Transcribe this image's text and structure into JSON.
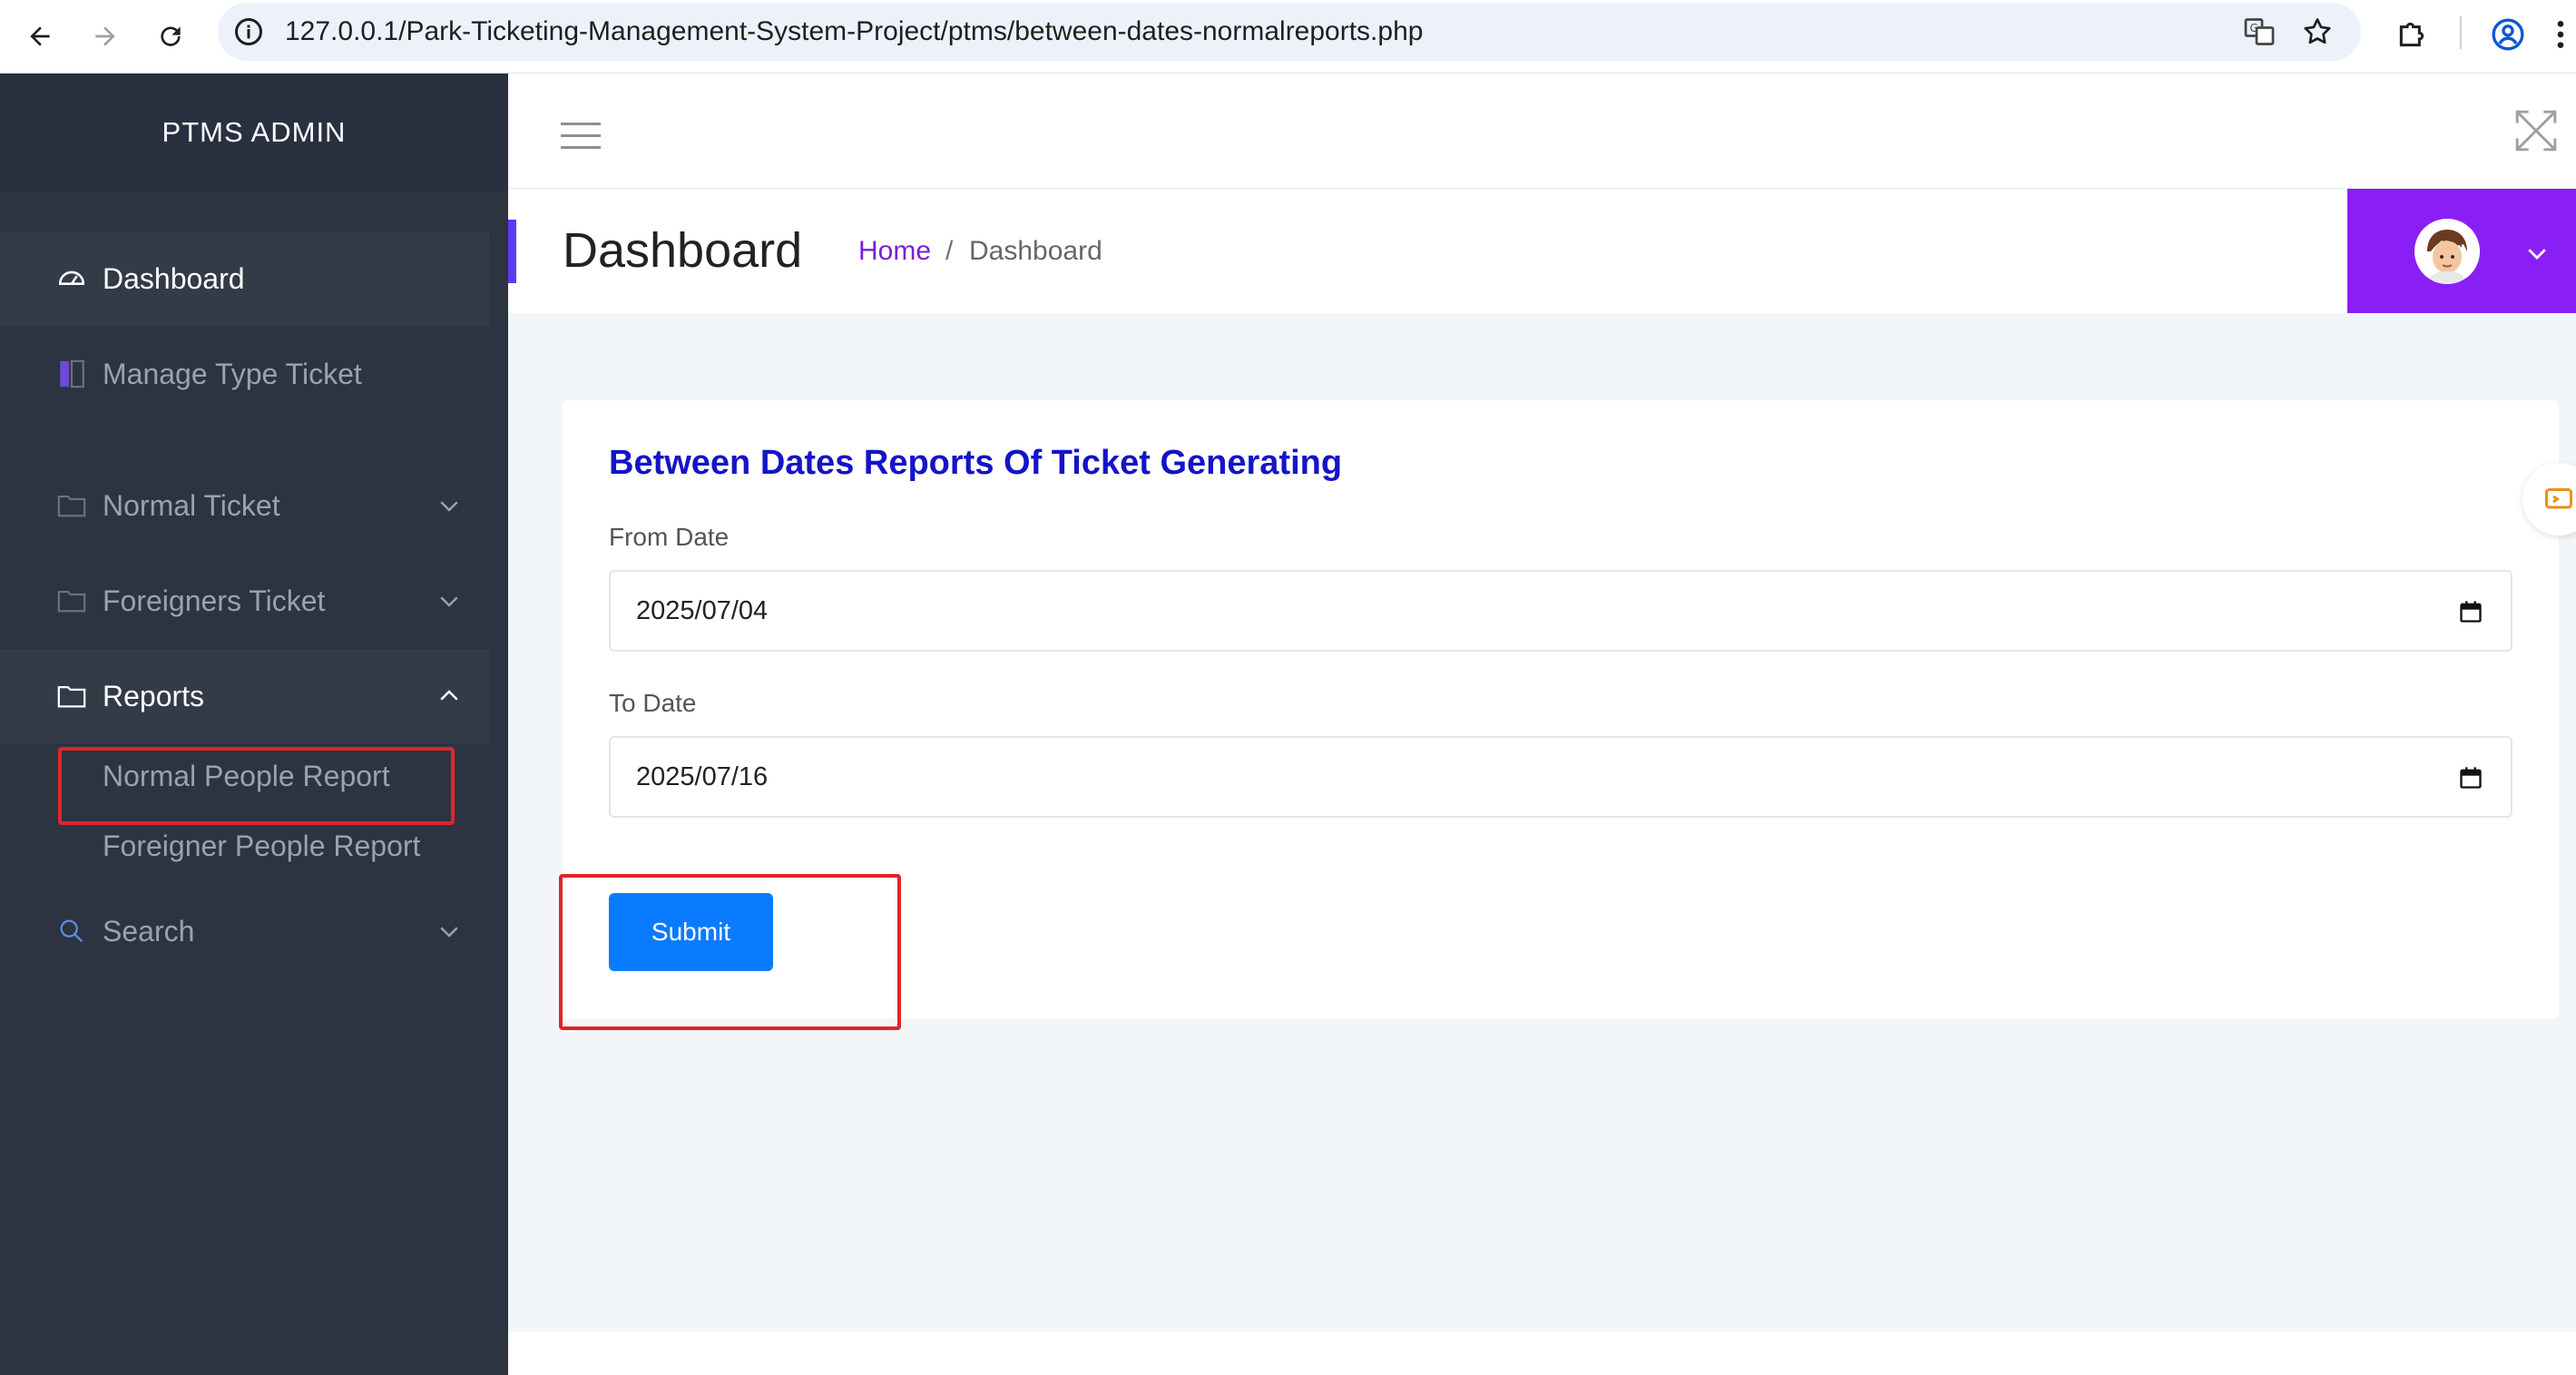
{
  "browser": {
    "url": "127.0.0.1/Park-Ticketing-Management-System-Project/ptms/between-dates-normalreports.php"
  },
  "sidebar": {
    "brand": "PTMS ADMIN",
    "items": [
      {
        "label": "Dashboard",
        "icon": "dashboard-gauge-icon"
      },
      {
        "label": "Manage Type Ticket",
        "icon": "book-icon"
      },
      {
        "label": "Normal Ticket",
        "icon": "folder-icon"
      },
      {
        "label": "Foreigners Ticket",
        "icon": "folder-icon"
      },
      {
        "label": "Reports",
        "icon": "folder-icon"
      },
      {
        "label": "Search",
        "icon": "search-icon"
      }
    ],
    "reports_submenu": [
      "Normal People Report",
      "Foreigner People Report"
    ]
  },
  "header": {
    "title": "Dashboard",
    "breadcrumb_home": "Home",
    "breadcrumb_sep": "/",
    "breadcrumb_current": "Dashboard"
  },
  "form": {
    "title": "Between Dates Reports Of Ticket Generating",
    "from_label": "From Date",
    "from_value": "2025/07/04",
    "to_label": "To Date",
    "to_value": "2025/07/16",
    "submit_label": "Submit"
  },
  "colors": {
    "sidebar_bg": "#2c3341",
    "accent_purple": "#8a1ff5",
    "submit_blue": "#0a7bff",
    "title_blue": "#1414c8",
    "highlight_red": "#e0252a"
  }
}
